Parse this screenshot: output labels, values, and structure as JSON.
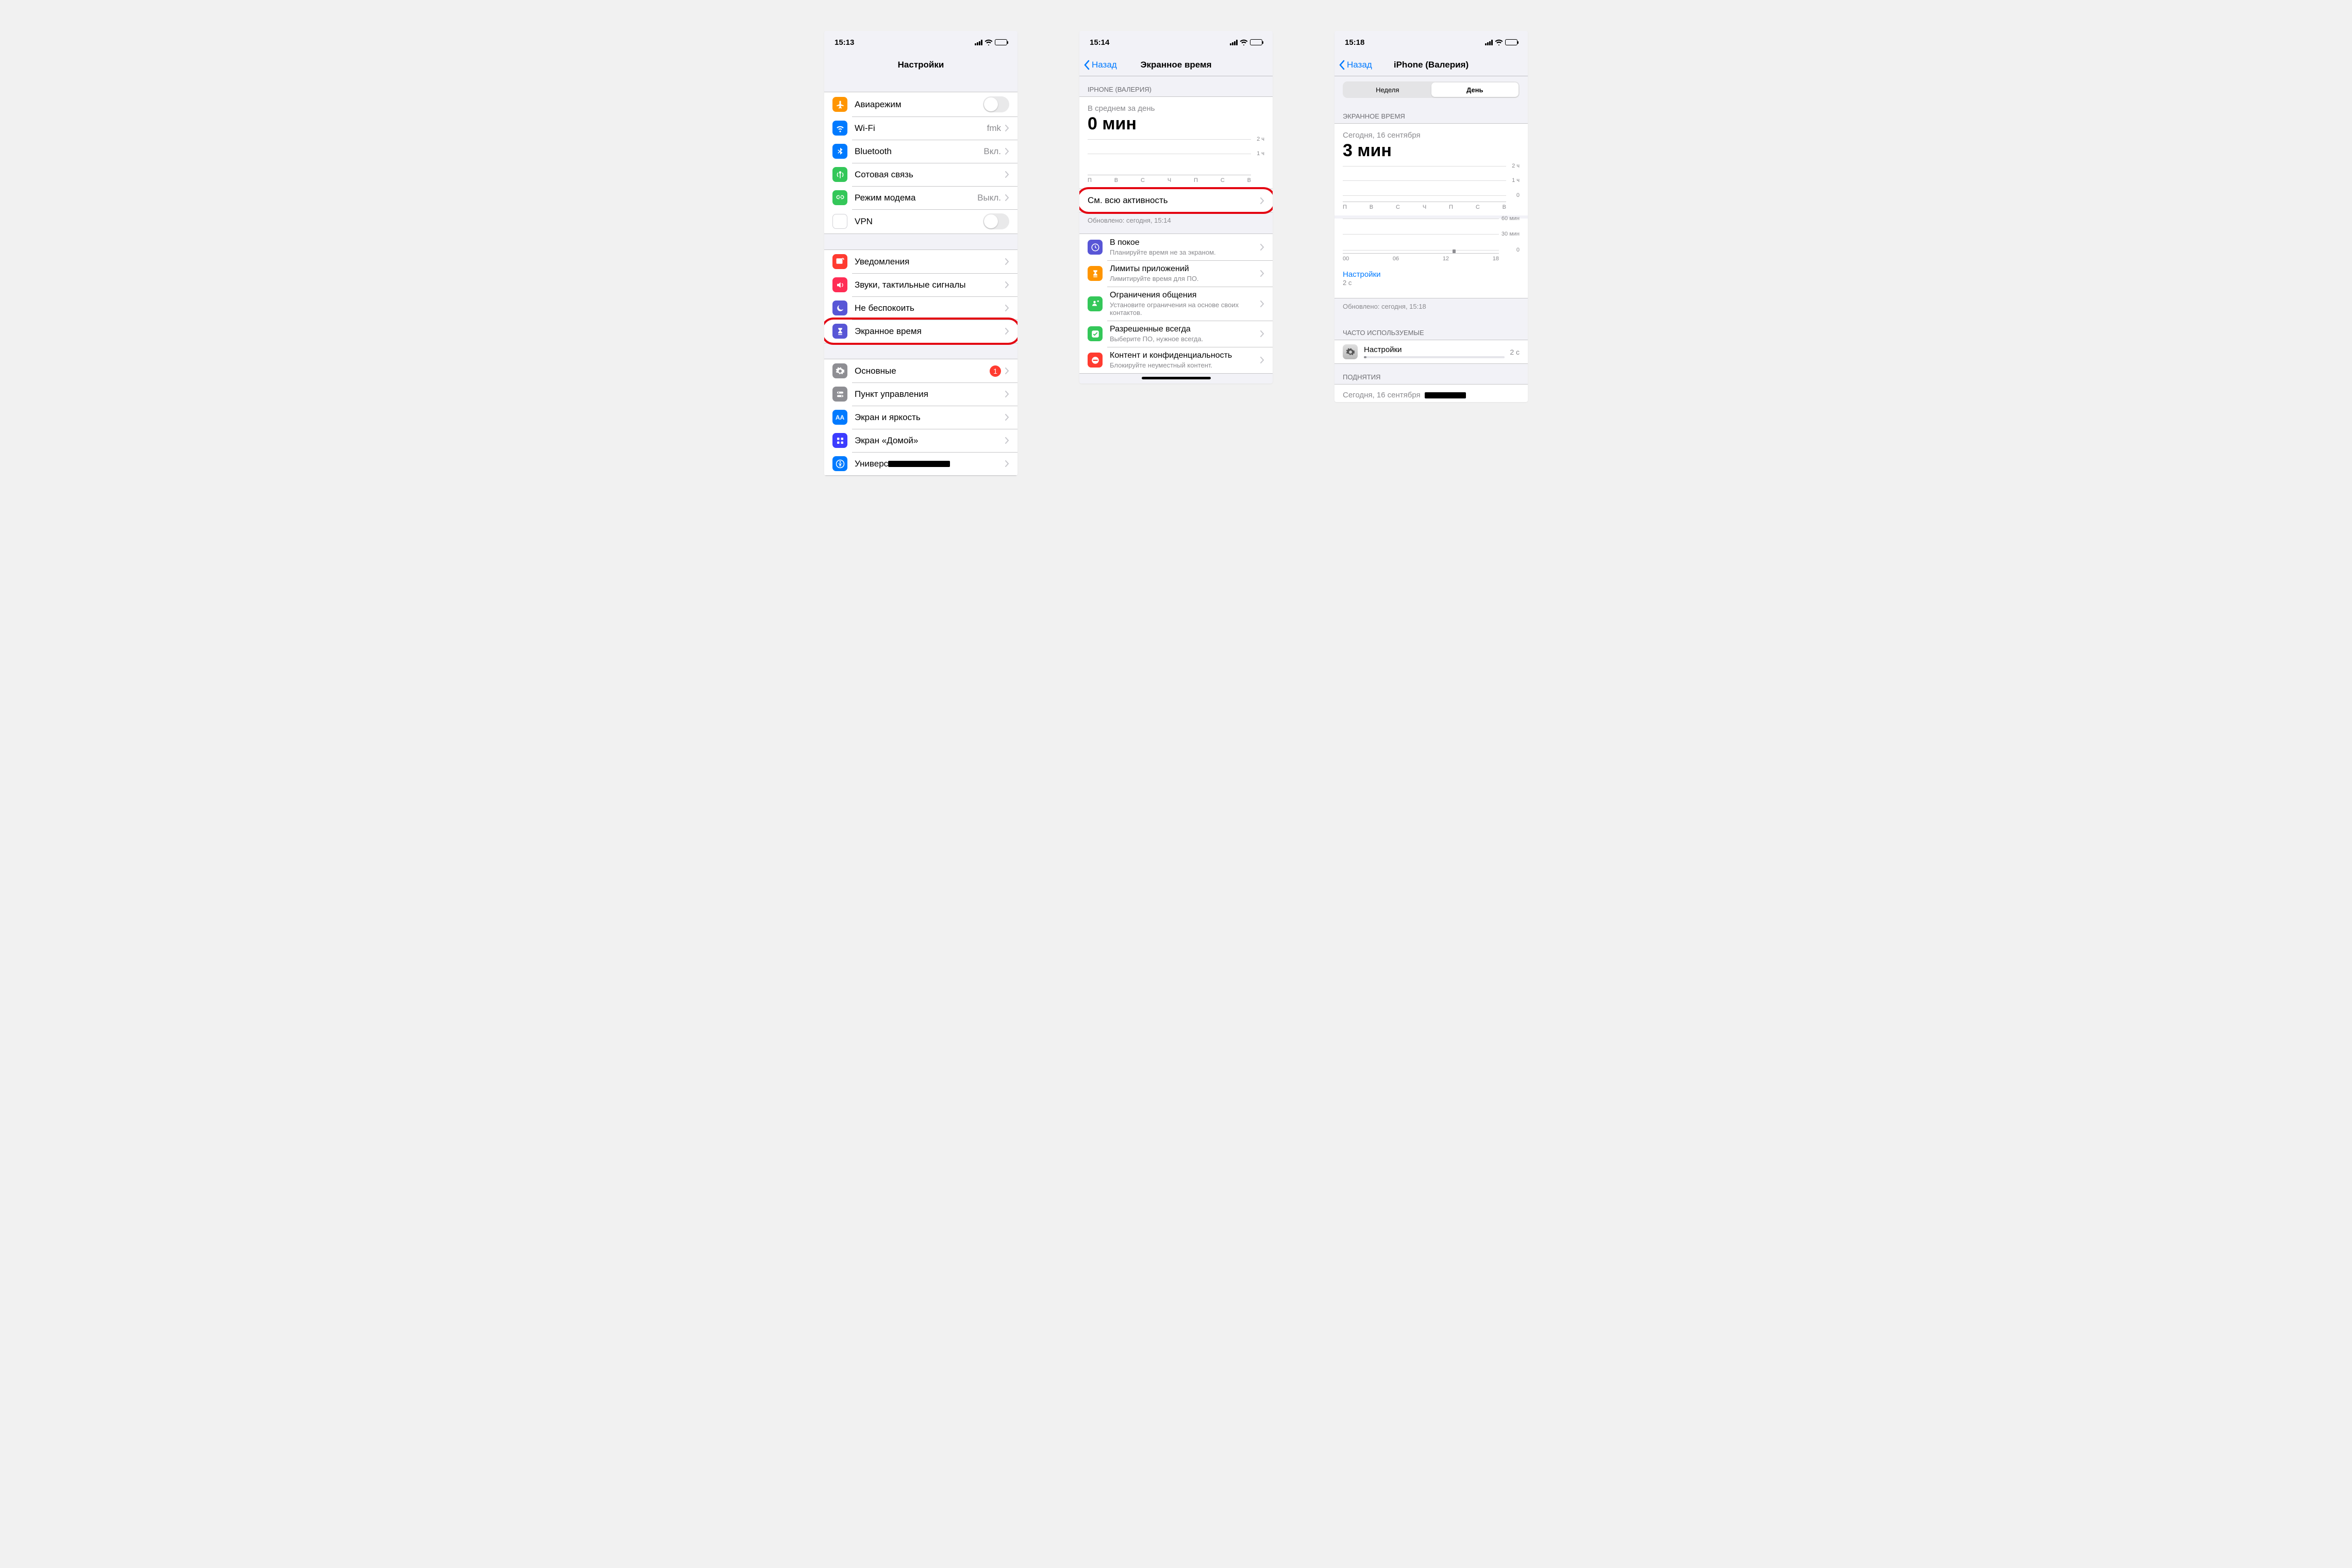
{
  "screens": {
    "settings": {
      "status": {
        "time": "15:13"
      },
      "nav": {
        "title": "Настройки",
        "back": null
      },
      "groups": [
        [
          {
            "id": "airplane",
            "label": "Авиарежим",
            "type": "toggle",
            "on": false,
            "icon": "airplane-icon",
            "iconColor": "#ff9500"
          },
          {
            "id": "wifi",
            "label": "Wi-Fi",
            "detail": "fmk",
            "type": "nav",
            "icon": "wifi-icon",
            "iconColor": "#007aff"
          },
          {
            "id": "bluetooth",
            "label": "Bluetooth",
            "detail": "Вкл.",
            "type": "nav",
            "icon": "bluetooth-icon",
            "iconColor": "#007aff"
          },
          {
            "id": "cellular",
            "label": "Сотовая связь",
            "type": "nav",
            "icon": "antenna-icon",
            "iconColor": "#34c759"
          },
          {
            "id": "hotspot",
            "label": "Режим модема",
            "detail": "Выкл.",
            "type": "nav",
            "icon": "link-icon",
            "iconColor": "#34c759"
          },
          {
            "id": "vpn",
            "label": "VPN",
            "type": "toggle",
            "on": false,
            "icon": "vpn-icon",
            "iconColor": "#ffffff",
            "iconText": "VPN"
          }
        ],
        [
          {
            "id": "notifications",
            "label": "Уведомления",
            "type": "nav",
            "icon": "bell-icon",
            "iconColor": "#ff3b30"
          },
          {
            "id": "sounds",
            "label": "Звуки, тактильные сигналы",
            "type": "nav",
            "icon": "speaker-icon",
            "iconColor": "#ff2d55"
          },
          {
            "id": "dnd",
            "label": "Не беспокоить",
            "type": "nav",
            "icon": "moon-icon",
            "iconColor": "#5856d6"
          },
          {
            "id": "screentime",
            "label": "Экранное время",
            "type": "nav",
            "icon": "hourglass-icon",
            "iconColor": "#5856d6",
            "highlight": true
          }
        ],
        [
          {
            "id": "general",
            "label": "Основные",
            "type": "nav",
            "badge": "1",
            "icon": "gear-icon",
            "iconColor": "#8e8e93"
          },
          {
            "id": "control",
            "label": "Пункт управления",
            "type": "nav",
            "icon": "switches-icon",
            "iconColor": "#8e8e93"
          },
          {
            "id": "display",
            "label": "Экран и яркость",
            "type": "nav",
            "icon": "aa-icon",
            "iconColor": "#007aff",
            "iconText": "AA"
          },
          {
            "id": "home",
            "label": "Экран «Домой»",
            "type": "nav",
            "icon": "grid-icon",
            "iconColor": "#2e3192"
          },
          {
            "id": "accessibility",
            "label": "Универсальный доступ",
            "type": "nav",
            "icon": "person-icon",
            "iconColor": "#007aff",
            "redacted": true
          }
        ]
      ]
    },
    "screentime": {
      "status": {
        "time": "15:14"
      },
      "nav": {
        "title": "Экранное время",
        "back": "Назад"
      },
      "header": "IPHONE (ВАЛЕРИЯ)",
      "avg_label": "В среднем за день",
      "avg_value": "0 мин",
      "chart": {
        "ylabels": [
          "2 ч",
          "1 ч"
        ],
        "xlabels": [
          "П",
          "В",
          "С",
          "Ч",
          "П",
          "С",
          "В"
        ]
      },
      "all_activity": {
        "label": "См. всю активность",
        "highlight": true
      },
      "updated": "Обновлено: сегодня, 15:14",
      "features": [
        {
          "id": "downtime",
          "label": "В покое",
          "sub": "Планируйте время не за экраном.",
          "icon": "clock-icon",
          "iconColor": "#5856d6"
        },
        {
          "id": "applimits",
          "label": "Лимиты приложений",
          "sub": "Лимитируйте время для ПО.",
          "icon": "hourglass-icon",
          "iconColor": "#ff9500"
        },
        {
          "id": "commlimits",
          "label": "Ограничения общения",
          "sub": "Установите ограничения на основе своих контактов.",
          "icon": "person-bubble-icon",
          "iconColor": "#34c759"
        },
        {
          "id": "allowed",
          "label": "Разрешенные всегда",
          "sub": "Выберите ПО, нужное всегда.",
          "icon": "checklist-icon",
          "iconColor": "#34c759"
        },
        {
          "id": "content",
          "label": "Контент и конфиденциальность",
          "sub": "Блокируйте неуместный контент.",
          "icon": "no-entry-icon",
          "iconColor": "#ff3b30"
        }
      ]
    },
    "detail": {
      "status": {
        "time": "15:18"
      },
      "nav": {
        "title": "iPhone (Валерия)",
        "back": "Назад"
      },
      "segmented": {
        "options": [
          "Неделя",
          "День"
        ],
        "active": 1
      },
      "section_header": "ЭКРАННОЕ ВРЕМЯ",
      "date": "Сегодня, 16 сентября",
      "total": "3 мин",
      "top_chart_ylabels": [
        "2 ч",
        "1 ч",
        "0"
      ],
      "top_chart_x": [
        "П",
        "В",
        "С",
        "Ч",
        "П",
        "С",
        "В"
      ],
      "bottom_chart_ylabels": [
        "60 мин",
        "30 мин",
        "0"
      ],
      "bottom_chart_hours": [
        "00",
        "06",
        "12",
        "18"
      ],
      "category": {
        "name": "Настройки",
        "time": "2 с"
      },
      "updated": "Обновлено: сегодня, 15:18",
      "most_used_header": "ЧАСТО ИСПОЛЬЗУЕМЫЕ",
      "most_used_item": {
        "name": "Настройки",
        "time": "2 с"
      },
      "pickups_header": "ПОДНЯТИЯ",
      "pickups_date": "Сегодня, 16 сентября"
    }
  },
  "chart_data": [
    {
      "type": "bar",
      "screen": "screentime-weekly-average",
      "title": "В среднем за день",
      "categories": [
        "П",
        "В",
        "С",
        "Ч",
        "П",
        "С",
        "В"
      ],
      "values": [
        0,
        0,
        0,
        0,
        0,
        0,
        0
      ],
      "ylabel": "ч",
      "ylim": [
        0,
        2
      ]
    },
    {
      "type": "bar",
      "screen": "detail-weekly-total",
      "title": "Сегодня, 16 сентября",
      "categories": [
        "П",
        "В",
        "С",
        "Ч",
        "П",
        "С",
        "В"
      ],
      "values": [
        0,
        0,
        0,
        0,
        0,
        0,
        0
      ],
      "ylabel": "ч",
      "ylim": [
        0,
        2
      ]
    },
    {
      "type": "bar",
      "screen": "detail-hourly",
      "x": [
        0,
        1,
        2,
        3,
        4,
        5,
        6,
        7,
        8,
        9,
        10,
        11,
        12,
        13,
        14,
        15,
        16,
        17,
        18,
        19,
        20,
        21,
        22,
        23
      ],
      "values": [
        0,
        0,
        0,
        0,
        0,
        0,
        0,
        0,
        0,
        0,
        0,
        0,
        0,
        0,
        0,
        3,
        0,
        0,
        0,
        0,
        0,
        0,
        0,
        0
      ],
      "ylabel": "мин",
      "ylim": [
        0,
        60
      ],
      "x_ticks": [
        "00",
        "06",
        "12",
        "18"
      ]
    }
  ]
}
